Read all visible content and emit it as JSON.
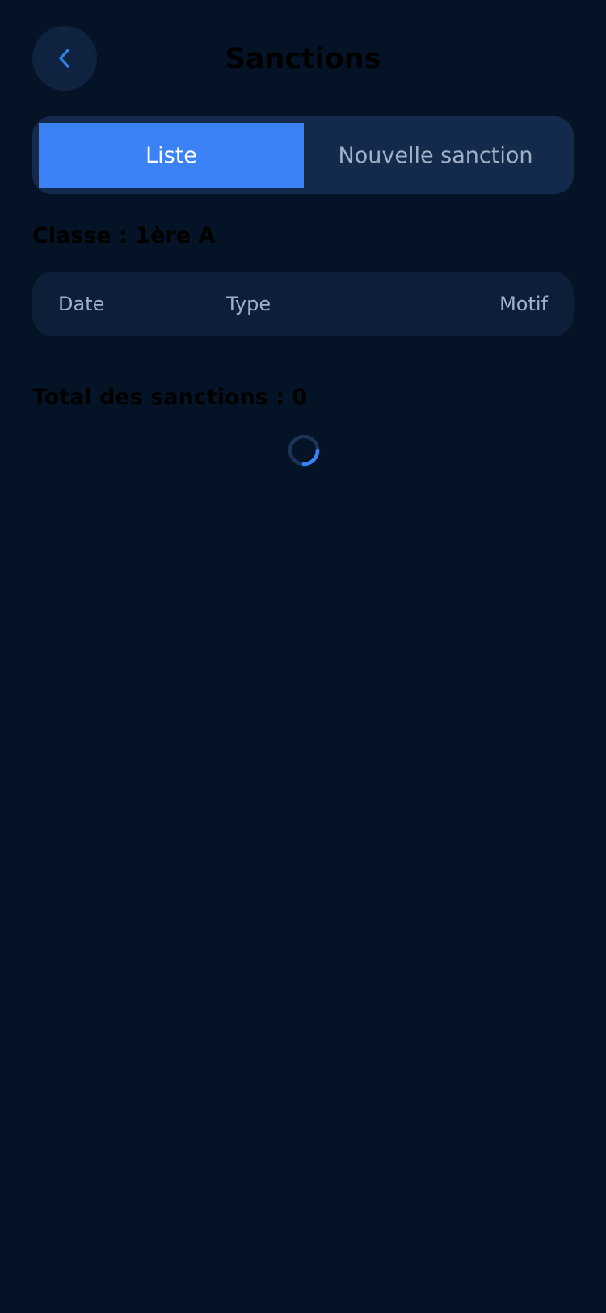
{
  "header": {
    "title": "Sanctions",
    "back_icon": "chevron-left-icon"
  },
  "tabs": [
    {
      "label": "Liste",
      "active": true
    },
    {
      "label": "Nouvelle sanction",
      "active": false
    }
  ],
  "class_label": "Classe : 1ère A",
  "table": {
    "columns": [
      "Date",
      "Type",
      "Motif"
    ]
  },
  "total_label": "Total des sanctions : 0",
  "loading_icon": "loading-spinner-icon",
  "colors": {
    "background": "#051326",
    "accent": "#3b82f6",
    "surface": "#142a4d",
    "muted_text": "#9fb0c8",
    "back_chevron": "#2f7ee0"
  }
}
